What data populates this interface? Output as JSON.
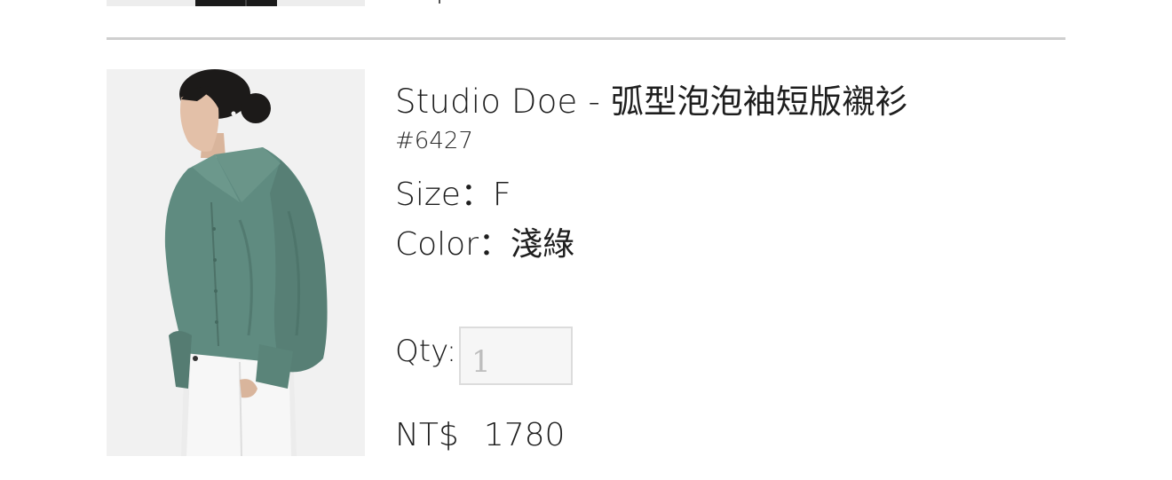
{
  "item": {
    "title": "Studio Doe - 弧型泡泡袖短版襯衫",
    "sku": "#6427",
    "size_label": "Size：",
    "size_value": "F",
    "color_label": "Color：",
    "color_value": "淺綠",
    "qty_label": "Qty:",
    "qty_value": "1",
    "price_currency": "NT$",
    "price_value": "1780"
  },
  "colors": {
    "divider": "#cfcfcf",
    "shirt": "#5f8b80",
    "image_bg": "#f0f0f0"
  }
}
